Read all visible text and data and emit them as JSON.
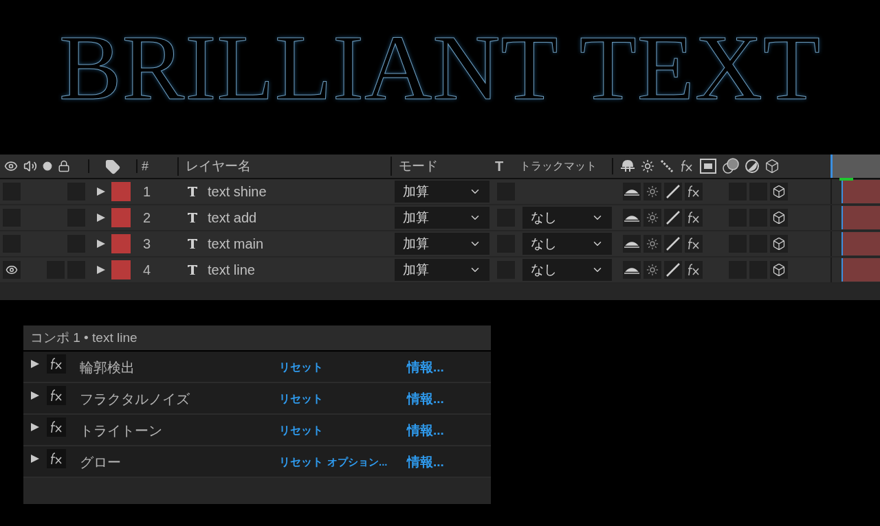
{
  "title_art": "BRILLIANT TEXT",
  "timeline": {
    "columns": {
      "number": "#",
      "layer_name": "レイヤー名",
      "mode": "モード",
      "t": "T",
      "track_matte": "トラックマット"
    },
    "layers": [
      {
        "visible": false,
        "number": "1",
        "name": "text shine",
        "mode": "加算",
        "color": "#b83a3a",
        "switches": {
          "shy": true,
          "collapse": true,
          "quality": true,
          "effects": true,
          "adjustment": false,
          "motion_blur": false,
          "three_d": true
        }
      },
      {
        "visible": false,
        "number": "2",
        "name": "text add",
        "mode": "加算",
        "track_matte": "なし",
        "color": "#b83a3a",
        "switches": {
          "shy": true,
          "collapse": true,
          "quality": true,
          "effects": true,
          "adjustment": false,
          "motion_blur": false,
          "three_d": true
        }
      },
      {
        "visible": false,
        "number": "3",
        "name": "text main",
        "mode": "加算",
        "track_matte": "なし",
        "color": "#b83a3a",
        "switches": {
          "shy": true,
          "collapse": true,
          "quality": true,
          "effects": true,
          "adjustment": false,
          "motion_blur": false,
          "three_d": true
        }
      },
      {
        "visible": true,
        "number": "4",
        "name": "text line",
        "mode": "加算",
        "track_matte": "なし",
        "color": "#b83a3a",
        "switches": {
          "shy": true,
          "collapse": true,
          "quality": true,
          "effects": true,
          "adjustment": false,
          "motion_blur": false,
          "three_d": true
        }
      }
    ]
  },
  "effect_controls": {
    "title": "コンポ 1 • text line",
    "effects": [
      {
        "name": "輪郭検出",
        "reset": "リセット",
        "about": "情報..."
      },
      {
        "name": "フラクタルノイズ",
        "reset": "リセット",
        "about": "情報..."
      },
      {
        "name": "トライトーン",
        "reset": "リセット",
        "about": "情報..."
      },
      {
        "name": "グロー",
        "reset": "リセット",
        "options": "オプション...",
        "about": "情報..."
      }
    ]
  }
}
